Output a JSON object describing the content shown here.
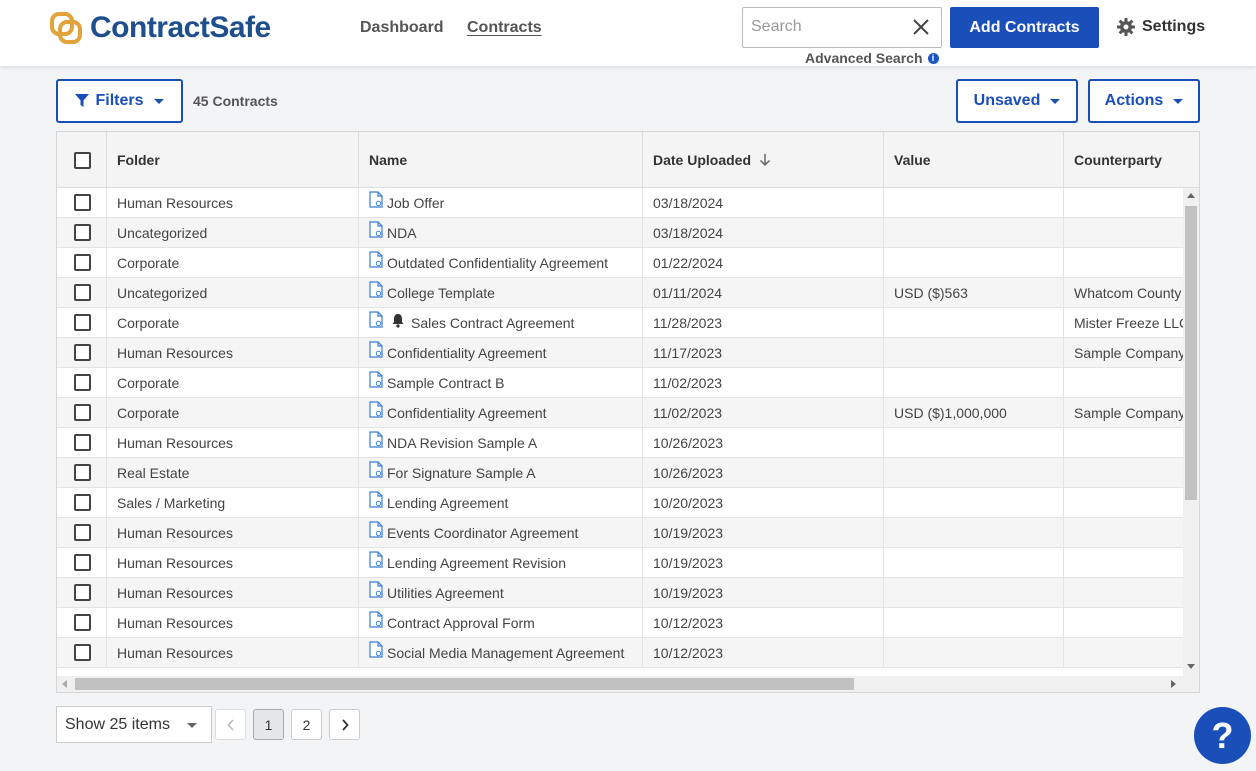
{
  "brand": {
    "name": "ContractSafe",
    "accent": "#1a4fba",
    "logo_color": "#e2a33a"
  },
  "nav": [
    {
      "label": "Dashboard"
    },
    {
      "label": "Contracts"
    }
  ],
  "search": {
    "placeholder": "Search",
    "value": "",
    "advanced_label": "Advanced Search",
    "info_icon": "i"
  },
  "header_actions": {
    "add_label": "Add Contracts",
    "settings_label": "Settings"
  },
  "toolbar": {
    "filters_label": "Filters",
    "count_label": "45 Contracts",
    "view_label": "Unsaved",
    "actions_label": "Actions"
  },
  "table": {
    "columns": [
      "Folder",
      "Name",
      "Date Uploaded",
      "Value",
      "Counterparty"
    ],
    "sort": {
      "column": "Date Uploaded",
      "direction": "desc"
    },
    "rows": [
      {
        "folder": "Human Resources",
        "name": "Job Offer",
        "date": "03/18/2024",
        "value": "",
        "counterparty": "",
        "bell": false
      },
      {
        "folder": "Uncategorized",
        "name": "NDA",
        "date": "03/18/2024",
        "value": "",
        "counterparty": "",
        "bell": false
      },
      {
        "folder": "Corporate",
        "name": "Outdated Confidentiality Agreement",
        "date": "01/22/2024",
        "value": "",
        "counterparty": "",
        "bell": false
      },
      {
        "folder": "Uncategorized",
        "name": "College Template",
        "date": "01/11/2024",
        "value": "USD ($)563",
        "counterparty": "Whatcom County",
        "bell": false
      },
      {
        "folder": "Corporate",
        "name": "Sales Contract Agreement",
        "date": "11/28/2023",
        "value": "",
        "counterparty": "Mister Freeze LLC",
        "bell": true
      },
      {
        "folder": "Human Resources",
        "name": "Confidentiality Agreement",
        "date": "11/17/2023",
        "value": "",
        "counterparty": "Sample Company",
        "bell": false
      },
      {
        "folder": "Corporate",
        "name": "Sample Contract B",
        "date": "11/02/2023",
        "value": "",
        "counterparty": "",
        "bell": false
      },
      {
        "folder": "Corporate",
        "name": "Confidentiality Agreement",
        "date": "11/02/2023",
        "value": "USD ($)1,000,000",
        "counterparty": "Sample Company",
        "bell": false
      },
      {
        "folder": "Human Resources",
        "name": "NDA Revision Sample A",
        "date": "10/26/2023",
        "value": "",
        "counterparty": "",
        "bell": false
      },
      {
        "folder": "Real Estate",
        "name": "For Signature Sample A",
        "date": "10/26/2023",
        "value": "",
        "counterparty": "",
        "bell": false
      },
      {
        "folder": "Sales / Marketing",
        "name": "Lending Agreement",
        "date": "10/20/2023",
        "value": "",
        "counterparty": "",
        "bell": false
      },
      {
        "folder": "Human Resources",
        "name": "Events Coordinator Agreement",
        "date": "10/19/2023",
        "value": "",
        "counterparty": "",
        "bell": false
      },
      {
        "folder": "Human Resources",
        "name": "Lending Agreement Revision",
        "date": "10/19/2023",
        "value": "",
        "counterparty": "",
        "bell": false
      },
      {
        "folder": "Human Resources",
        "name": "Utilities Agreement",
        "date": "10/19/2023",
        "value": "",
        "counterparty": "",
        "bell": false
      },
      {
        "folder": "Human Resources",
        "name": "Contract Approval Form",
        "date": "10/12/2023",
        "value": "",
        "counterparty": "",
        "bell": false
      },
      {
        "folder": "Human Resources",
        "name": "Social Media Management Agreement",
        "date": "10/12/2023",
        "value": "",
        "counterparty": "",
        "bell": false
      }
    ]
  },
  "pagination": {
    "page_size_label": "Show 25 items",
    "pages": [
      "1",
      "2"
    ],
    "current": "1"
  },
  "help": {
    "label": "?"
  }
}
